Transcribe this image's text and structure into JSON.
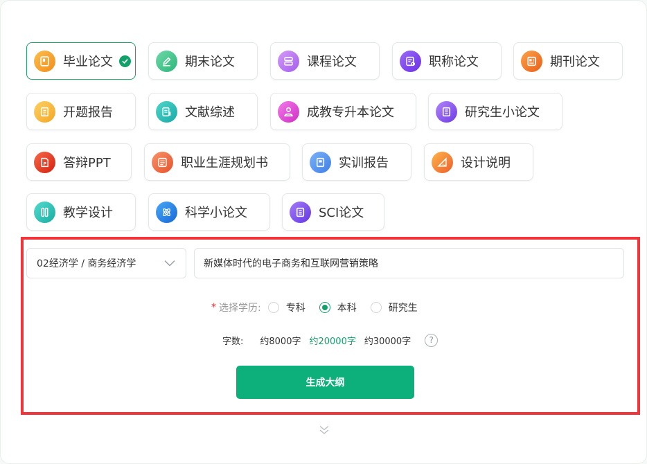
{
  "paper_types": [
    {
      "label": "毕业论文",
      "icon": "graduation-paper-icon",
      "color": "#f7a325",
      "active": true
    },
    {
      "label": "期末论文",
      "icon": "pen-edit-icon",
      "color": "#3cc38a",
      "active": false
    },
    {
      "label": "课程论文",
      "icon": "course-list-icon",
      "color": "#b56cf2",
      "active": false
    },
    {
      "label": "职称论文",
      "icon": "title-certificate-icon",
      "color": "#7a3cf0",
      "active": false
    },
    {
      "label": "期刊论文",
      "icon": "journal-icon",
      "color": "#f07a1e",
      "active": false
    },
    {
      "label": "开题报告",
      "icon": "proposal-report-icon",
      "color": "#f8b62f",
      "active": false
    },
    {
      "label": "文献综述",
      "icon": "literature-review-icon",
      "color": "#1fb8b0",
      "active": false
    },
    {
      "label": "成教专升本论文",
      "icon": "adult-education-icon",
      "color": "#e546d6",
      "active": false
    },
    {
      "label": "研究生小论文",
      "icon": "postgraduate-paper-icon",
      "color": "#8a4ef0",
      "active": false
    },
    {
      "label": "答辩PPT",
      "icon": "ppt-icon",
      "color": "#e8341c",
      "active": false
    },
    {
      "label": "职业生涯规划书",
      "icon": "career-plan-icon",
      "color": "#f2683a",
      "active": false
    },
    {
      "label": "实训报告",
      "icon": "training-report-icon",
      "color": "#4b8ff2",
      "active": false
    },
    {
      "label": "设计说明",
      "icon": "design-ruler-icon",
      "color": "#f58a1f",
      "active": false
    },
    {
      "label": "教学设计",
      "icon": "teaching-design-icon",
      "color": "#20c2b3",
      "active": false
    },
    {
      "label": "科学小论文",
      "icon": "science-atom-icon",
      "color": "#1a7fe6",
      "active": false
    },
    {
      "label": "SCI论文",
      "icon": "sci-paper-icon",
      "color": "#7a44ef",
      "active": false
    }
  ],
  "form": {
    "subject_select": "02经济学 / 商务经济学",
    "topic_value": "新媒体时代的电子商务和互联网营销策略",
    "education_required_mark": "*",
    "education_label": "选择学历:",
    "education_options": [
      "专科",
      "本科",
      "研究生"
    ],
    "education_selected": "本科",
    "word_count_label": "字数:",
    "word_count_options": [
      "约8000字",
      "约20000字",
      "约30000字"
    ],
    "word_count_selected": "约20000字",
    "help_symbol": "?",
    "generate_button": "生成大纲"
  },
  "colors": {
    "accent": "#12a16a",
    "button": "#0db07a",
    "highlight_border": "#f2353b"
  }
}
